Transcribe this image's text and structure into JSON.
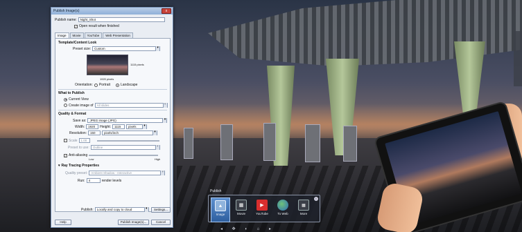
{
  "dialog": {
    "title": "Publish Image(s)",
    "close_label": "x",
    "publish_name_label": "Publish name:",
    "publish_name_value": "Night_Shot",
    "open_result_label": "Open result when finished",
    "tabs": [
      "Image",
      "Movie",
      "YouTube",
      "Web Presentation"
    ],
    "template_section": "Template/Content Look",
    "preset_size_label": "Preset size:",
    "preset_size_value": "Custom",
    "height_caption": "1115 pixels",
    "width_caption": "1920 pixels",
    "orientation_label": "Orientation:",
    "portrait_label": "Portrait",
    "landscape_label": "Landscape",
    "what_section": "What to Publish",
    "current_view_label": "Current View",
    "create_image_label": "Create image of",
    "create_image_value": "All slides",
    "quality_section": "Quality & Format",
    "save_as_label": "Save as:",
    "save_as_value": "JPEG image (JPG)",
    "width_label": "Width:",
    "width_value": "1920",
    "height_label": "Height:",
    "height_value": "1115",
    "unit_value": "pixels",
    "resolution_label": "Resolution:",
    "resolution_value": "150",
    "resolution_unit": "pixels/inch",
    "scale_label": "Scale",
    "scale_value": "1.00",
    "preset_to_use_label": "Preset to use:",
    "preset_to_use_value": "Outline",
    "anti_aliasing_label": "Anti-aliasing",
    "low_label": "Low",
    "high_label": "High",
    "ray_tracing_section": "Ray Tracing Properties",
    "quality_preset_label": "Quality preset:",
    "quality_preset_value": "Ambient Shadow - Interactive",
    "run_label": "Run:",
    "run_value": "4",
    "render_levels_label": "render levels",
    "publish_label": "Publish:",
    "publish_value": "Locally and copy to cloud",
    "settings_button": "Settings...",
    "help_button": "Help",
    "publish_button": "Publish Image(s)...",
    "cancel_button": "Cancel"
  },
  "publish_toolbar": {
    "title": "Publish",
    "items": [
      {
        "label": "Image",
        "icon": "image-icon"
      },
      {
        "label": "Movie",
        "icon": "film-icon"
      },
      {
        "label": "YouTube",
        "icon": "youtube-icon"
      },
      {
        "label": "To Web",
        "icon": "globe-icon"
      },
      {
        "label": "More",
        "icon": "grid-icon"
      }
    ],
    "info_label": "i"
  },
  "colors": {
    "active_item": "#2e5f9f",
    "dialog_bg": "#e9edf3",
    "youtube_red": "#d92e2e"
  }
}
